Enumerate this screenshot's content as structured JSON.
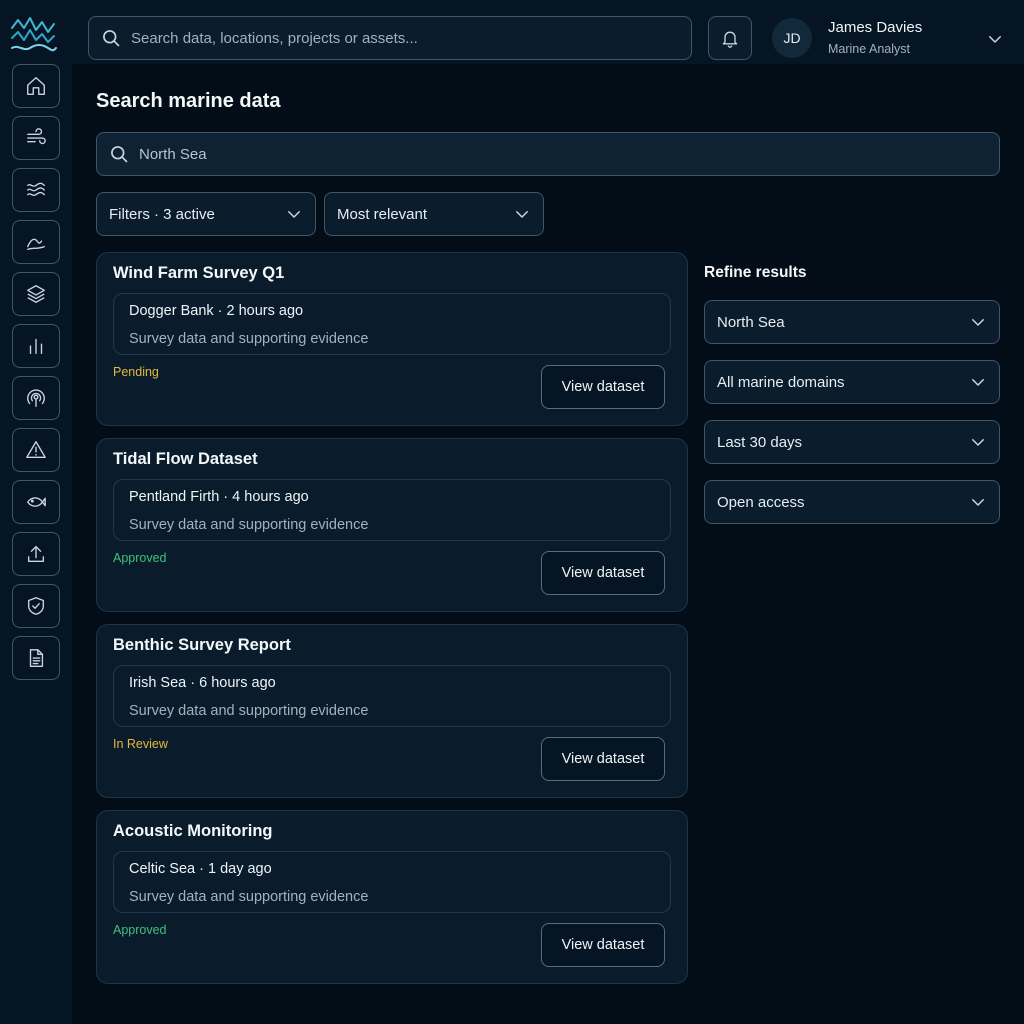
{
  "header": {
    "search_placeholder": "Search data, locations, projects or assets...",
    "user": {
      "initials": "JD",
      "name": "James Davies",
      "role": "Marine Analyst"
    }
  },
  "sidebar": {
    "items": [
      {
        "icon": "home-icon"
      },
      {
        "icon": "wind-icon"
      },
      {
        "icon": "waves-icon"
      },
      {
        "icon": "tide-icon"
      },
      {
        "icon": "layers-icon"
      },
      {
        "icon": "bar-chart-icon"
      },
      {
        "icon": "signal-icon"
      },
      {
        "icon": "alert-icon"
      },
      {
        "icon": "fish-icon"
      },
      {
        "icon": "upload-icon"
      },
      {
        "icon": "shield-check-icon"
      },
      {
        "icon": "document-icon"
      }
    ]
  },
  "main": {
    "title": "Search marine data",
    "search_value": "North Sea",
    "filters_label": "Filters · 3 active",
    "sort_label": "Most relevant",
    "results": [
      {
        "title": "Wind Farm Survey Q1",
        "meta": "Dogger Bank · 2 hours ago",
        "description": "Survey data and supporting evidence",
        "status": "Pending",
        "status_color": "#e3b93c",
        "button": "View dataset"
      },
      {
        "title": "Tidal Flow Dataset",
        "meta": "Pentland Firth · 4 hours ago",
        "description": "Survey data and supporting evidence",
        "status": "Approved",
        "status_color": "#3fc07e",
        "button": "View dataset"
      },
      {
        "title": "Benthic Survey Report",
        "meta": "Irish Sea · 6 hours ago",
        "description": "Survey data and supporting evidence",
        "status": "In Review",
        "status_color": "#e3b93c",
        "button": "View dataset"
      },
      {
        "title": "Acoustic Monitoring",
        "meta": "Celtic Sea · 1 day ago",
        "description": "Survey data and supporting evidence",
        "status": "Approved",
        "status_color": "#3fc07e",
        "button": "View dataset"
      }
    ]
  },
  "refine": {
    "title": "Refine results",
    "filters": [
      "North Sea",
      "All marine domains",
      "Last 30 days",
      "Open access"
    ]
  }
}
